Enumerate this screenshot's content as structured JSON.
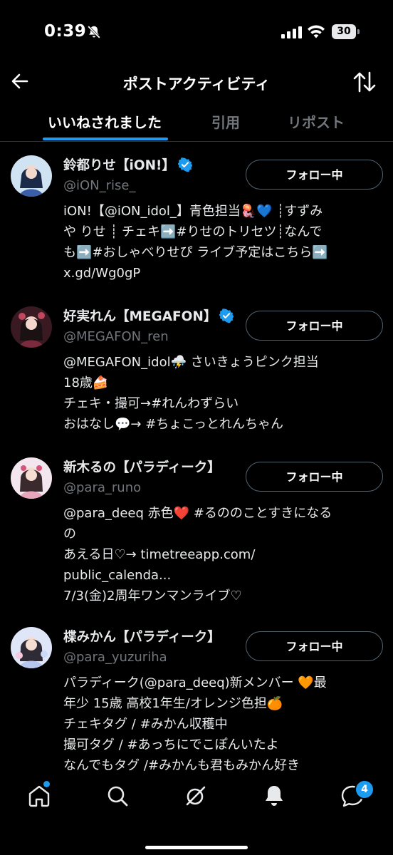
{
  "status_bar": {
    "time": "0:39",
    "battery": "30"
  },
  "header": {
    "title": "ポストアクティビティ"
  },
  "tabs": [
    {
      "label": "いいねされました"
    },
    {
      "label": "引用"
    },
    {
      "label": "リポスト"
    }
  ],
  "users": [
    {
      "name": "鈴都りせ【iON!】",
      "handle": "@iON_rise_",
      "follow_label": "フォロー中",
      "bio_lines": [
        "iON!【@iON_idol_】青色担当🪼💙 ┊すずみ",
        "や りせ ┊ チェキ➡️#りせのトリセツ┊なんで",
        "も➡️#おしゃべりせぴ ライブ予定はこちら➡️",
        "x.gd/Wg0gP"
      ]
    },
    {
      "name": "好実れん【MEGAFON】",
      "handle": "@MEGAFON_ren",
      "follow_label": "フォロー中",
      "bio_lines": [
        "@MEGAFON_idol⛈️ さいきょうピンク担当",
        "18歳🍰",
        "チェキ・撮可→#れんわずらい",
        "おはなし💬→ #ちょこっとれんちゃん"
      ]
    },
    {
      "name": "新木るの【パラディーク】",
      "handle": "@para_runo",
      "follow_label": "フォロー中",
      "bio_lines": [
        "@para_deeq 赤色❤️ #るののことすきになる",
        "の",
        "あえる日♡→ timetreeapp.com/",
        "public_calenda...",
        "7/3(金)2周年ワンマンライブ♡"
      ]
    },
    {
      "name": "楪みかん【パラディーク】",
      "handle": "@para_yuzuriha",
      "follow_label": "フォロー中",
      "bio_lines": [
        "パラディーク(@para_deeq)新メンバー 🧡最",
        "年少 15歳 高校1年生/オレンジ色担🍊",
        "チェキタグ / #みかん収穫中",
        "撮可タグ / #あっちにでこぽんいたよ",
        "なんでもタグ /#みかんも君もみかん好き"
      ]
    }
  ],
  "bottom_nav": {
    "items": [
      "home-icon",
      "search-icon",
      "grok-icon",
      "notifications-icon",
      "messages-icon"
    ],
    "messages_badge": "4"
  },
  "colors": {
    "accent": "#1d9bf0",
    "background": "#000000",
    "secondary_text": "#71767b"
  }
}
